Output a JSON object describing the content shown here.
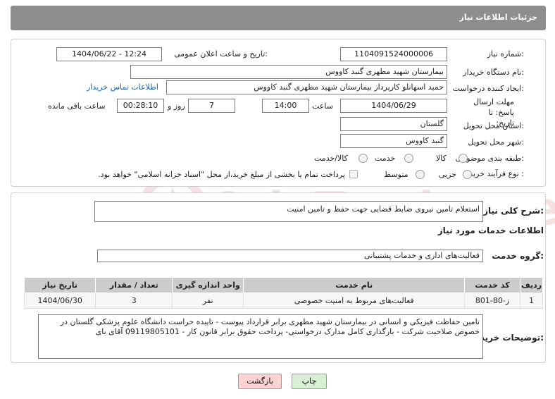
{
  "header": {
    "title": "جزئیات اطلاعات نیاز"
  },
  "form": {
    "need_number_label": "شماره نیاز:",
    "need_number": "1104091524000006",
    "announce_label": "تاریخ و ساعت اعلان عمومی:",
    "announce_value": "1404/06/22 - 12:24",
    "buyer_org_label": "نام دستگاه خریدار:",
    "buyer_org": "بیمارستان شهید مطهری گنبد کاووس",
    "creator_label": "ایجاد کننده درخواست:",
    "creator": "حمید اسهانلو کارپرداز بیمارستان شهید مطهری گنبد کاووس",
    "contact_link": "اطلاعات تماس خریدار",
    "deadline_label": "مهلت ارسال پاسخ: تا تاریخ:",
    "deadline_date": "1404/06/29",
    "time_label": "ساعت",
    "deadline_time": "14:00",
    "days_value": "7",
    "days_label": "روز و",
    "remaining_time": "00:28:10",
    "remaining_label": "ساعت باقی مانده",
    "province_label": "استان محل تحویل:",
    "province": "گلستان",
    "city_label": "شهر محل تحویل:",
    "city": "گنبد کاووس",
    "category_label": "طبقه بندی موضوعی:",
    "category_options": [
      "کالا",
      "خدمت",
      "کالا/خدمت"
    ],
    "process_label": "نوع فرآیند خرید :",
    "process_options": [
      "جزیی",
      "متوسط"
    ],
    "payment_note": "پرداخت تمام یا بخشی از مبلغ خرید،از محل \"اسناد خزانه اسلامی\" خواهد بود."
  },
  "summary": {
    "label": "شرح کلی نیاز:",
    "text": "استعلام تامین نیروی  ضابط  قضایی  جهت حفظ و تامین امنیت"
  },
  "services": {
    "section_title": "اطلاعات خدمات مورد نیاز",
    "group_label": "گروه خدمت:",
    "group_value": "فعالیت‌های اداری و خدمات پشتیبانی",
    "columns": [
      "ردیف",
      "کد خدمت",
      "نام خدمت",
      "واحد اندازه گیری",
      "تعداد / مقدار",
      "تاریخ نیاز"
    ],
    "rows": [
      [
        "1",
        "ز-80-801",
        "فعالیت‌های مربوط به امنیت خصوصی",
        "نفر",
        "3",
        "1404/06/30"
      ]
    ]
  },
  "buyer_notes": {
    "label": "توضیحات خریدار:",
    "text": "تامین حفاظت فیزیکی و انسانی در بیمارستان شهید مطهری برابر قرارداد پیوست - تاییده حراست دانشگاه علوم پزشکی گلستان در خصوص صلاحیت شرکت - بارگذاری کامل مدارک درخواستی- پرداخت حقوق برابر قانون کار - 09119805101 آقای بای"
  },
  "buttons": {
    "print": "چاپ",
    "return": "بازگشت"
  },
  "watermark": {
    "text": "AriaTender.neT"
  }
}
